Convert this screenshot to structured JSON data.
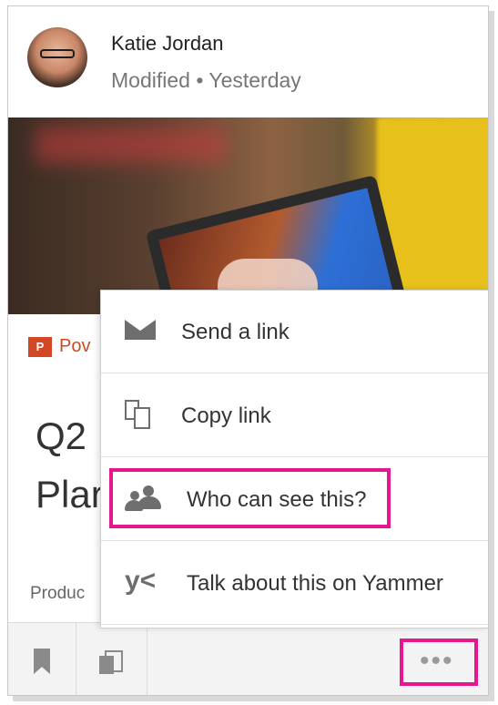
{
  "card": {
    "author": "Katie Jordan",
    "modified": "Modified • Yesterday",
    "doc_type_badge": "P",
    "doc_type": "Pov",
    "title": "Q2\nPlar",
    "subtitle": "Produc"
  },
  "menu": {
    "items": [
      {
        "label": "Send a link",
        "icon": "mail-icon"
      },
      {
        "label": "Copy link",
        "icon": "copy-link-icon"
      },
      {
        "label": "Who can see this?",
        "icon": "people-icon",
        "highlighted": true
      },
      {
        "label": "Talk about this on Yammer",
        "icon": "yammer-icon"
      }
    ]
  },
  "footer": {
    "bookmark_icon": "bookmark-icon",
    "copy_icon": "copy-icon",
    "more_label": "•••"
  },
  "colors": {
    "highlight": "#e5168e",
    "powerpoint": "#d24726"
  }
}
